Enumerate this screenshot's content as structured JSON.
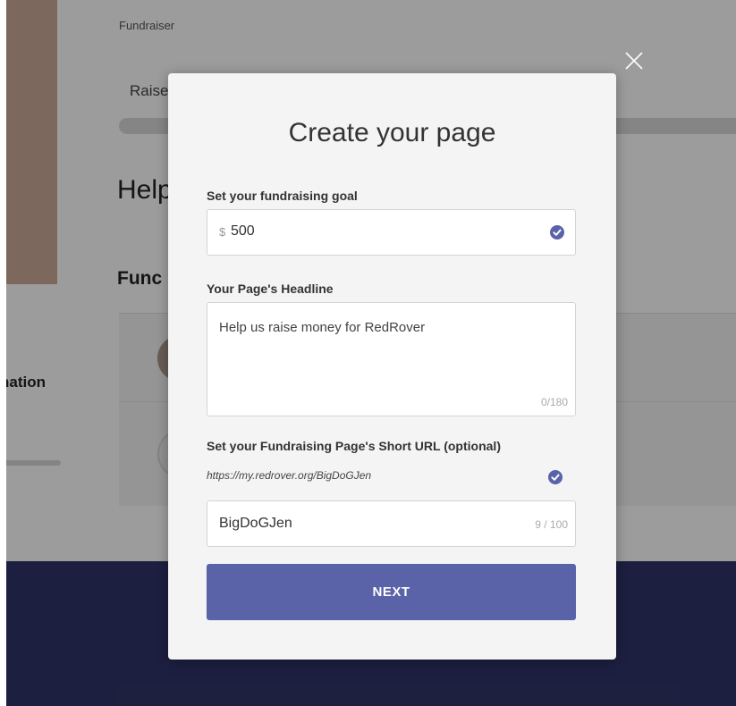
{
  "background": {
    "breadcrumb": "Fundraiser",
    "raise_text": "Raise",
    "heading": "Help",
    "subheading": "Func",
    "side_label": "nation"
  },
  "modal": {
    "title": "Create your page",
    "goal": {
      "label": "Set your fundraising goal",
      "currency": "$",
      "value": "500",
      "check_icon": "check-circle-icon"
    },
    "headline": {
      "label": "Your Page's Headline",
      "value": "Help us raise money for RedRover",
      "counter": "0/180"
    },
    "short_url": {
      "label": "Set your Fundraising Page's Short URL (optional)",
      "preview": "https://my.redrover.org/BigDoGJen",
      "check_icon": "check-circle-icon",
      "value": "BigDoGJen",
      "counter": "9 / 100"
    },
    "next_label": "NEXT",
    "close_icon": "close-icon"
  },
  "colors": {
    "accent": "#5a62a8",
    "check": "#5a62a8",
    "footer": "#2e3366",
    "modal_bg": "#f4f4f4"
  }
}
